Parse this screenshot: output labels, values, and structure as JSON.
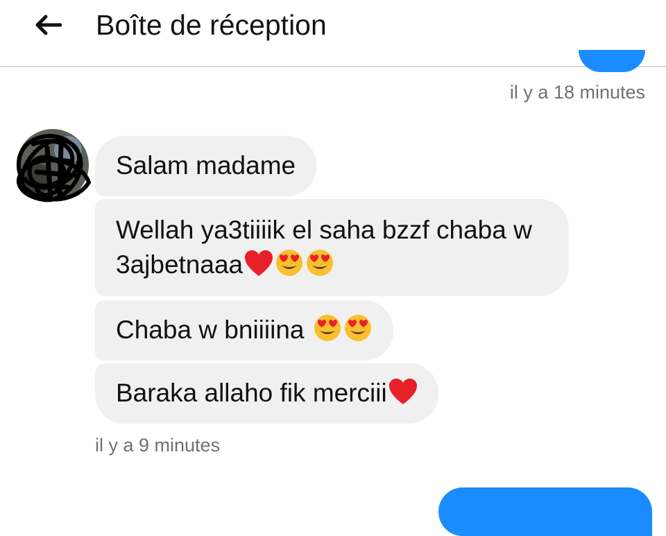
{
  "header": {
    "title": "Boîte de réception",
    "back_icon": "arrow-left-icon"
  },
  "thread": {
    "timestamp_top": "il y a 18 minutes",
    "timestamp_bottom": "il y a 9 minutes",
    "messages": [
      {
        "text": "Salam madame",
        "emoji": []
      },
      {
        "text": "Wellah ya3tiiiik el saha bzzf chaba w 3ajbetnaaa",
        "emoji": [
          "red-heart-icon",
          "heart-eyes-icon",
          "heart-eyes-icon"
        ]
      },
      {
        "text": "Chaba w bniiiina ",
        "emoji": [
          "heart-eyes-icon",
          "heart-eyes-icon"
        ]
      },
      {
        "text": "Baraka allaho fik merciii",
        "emoji": [
          "red-heart-icon"
        ]
      }
    ]
  },
  "colors": {
    "sent_bubble": "#1a8cff",
    "received_bubble": "#f0f0f0",
    "timestamp": "#707070",
    "divider": "#d6d6d6"
  }
}
